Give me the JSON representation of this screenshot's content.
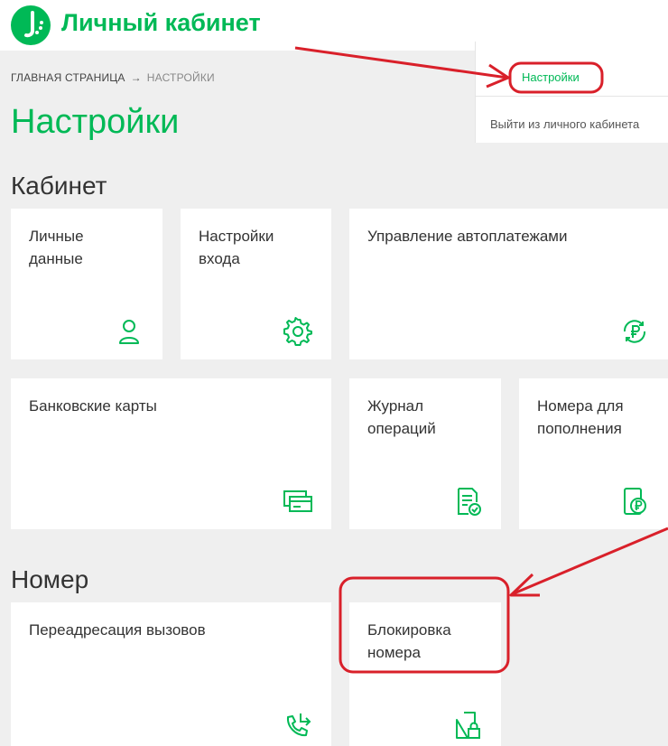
{
  "header": {
    "brand": "Личный кабинет"
  },
  "dropdown": {
    "settings_label": "Настройки",
    "logout_label": "Выйти из личного кабинета"
  },
  "breadcrumb": {
    "home": "ГЛАВНАЯ СТРАНИЦА",
    "separator": "→",
    "current": "НАСТРОЙКИ"
  },
  "page_title": "Настройки",
  "sections": {
    "cabinet": {
      "title": "Кабинет",
      "tiles": [
        {
          "label": "Личные\nданные",
          "icon": "user-icon"
        },
        {
          "label": "Настройки\nвхода",
          "icon": "gear-icon"
        },
        {
          "label": "Управление автоплатежами",
          "icon": "ruble-refresh-icon"
        },
        {
          "label": "Банковские карты",
          "icon": "cards-icon"
        },
        {
          "label": "Журнал\nопераций",
          "icon": "document-check-icon"
        },
        {
          "label": "Номера для\nпополнения",
          "icon": "phone-ruble-icon"
        }
      ]
    },
    "number": {
      "title": "Номер",
      "tiles": [
        {
          "label": "Переадресация вызовов",
          "icon": "call-forward-icon"
        },
        {
          "label": "Блокировка\nномера",
          "icon": "sim-lock-icon"
        }
      ]
    }
  },
  "colors": {
    "accent": "#00b956",
    "annotation": "#d9202a",
    "background": "#efefef"
  }
}
